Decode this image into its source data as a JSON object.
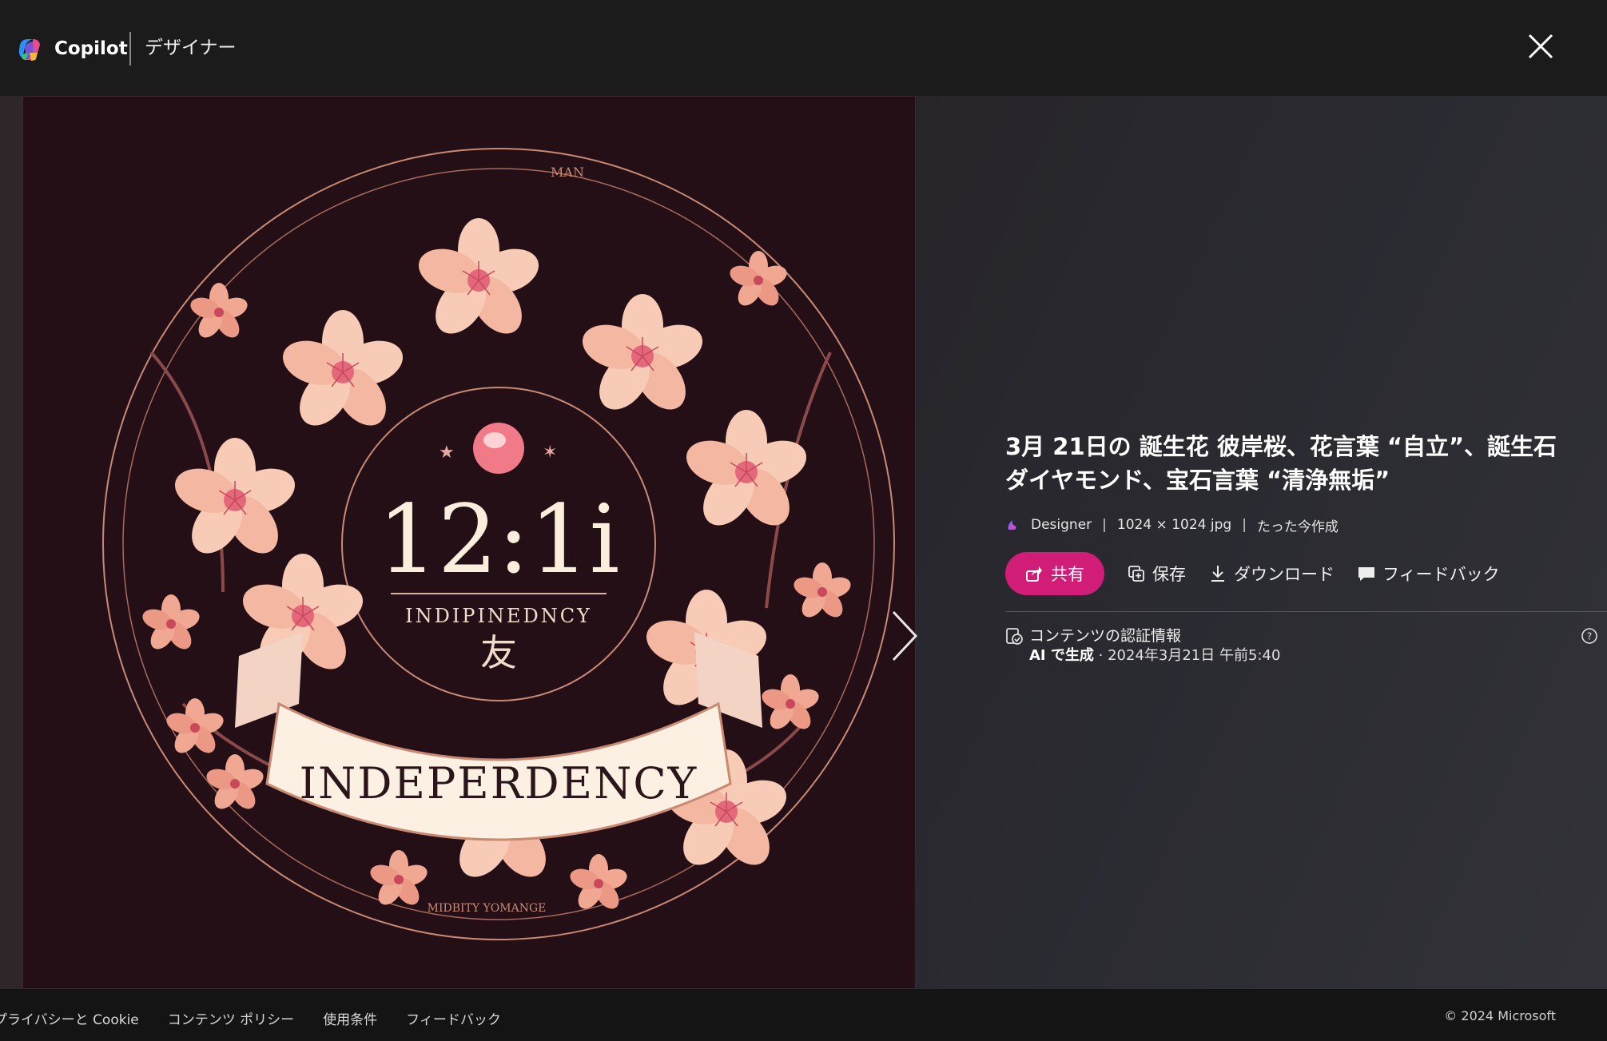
{
  "header": {
    "brand": "Copilot",
    "sub_brand": "デザイナー",
    "close_icon": "close-icon"
  },
  "image": {
    "numerals": "12:1i",
    "small_text": "INDIPINEDNCY",
    "kanji": "友",
    "banner_text": "INDEPERDENCY",
    "ring_top": "MAN",
    "ring_bottom": "MIDBITY YOMANGE"
  },
  "info": {
    "title": "3月 21日の 誕生花 彼岸桜、花言葉 “自立”、誕生石 ダイヤモンド、宝石言葉 “清浄無垢”",
    "meta": {
      "source": "Designer",
      "size": "1024 × 1024 jpg",
      "created": "たった今作成"
    },
    "actions": {
      "share": "共有",
      "save": "保存",
      "download": "ダウンロード",
      "feedback": "フィードバック"
    },
    "credentials": {
      "title": "コンテンツの認証情報",
      "ai_label": "AI で生成",
      "date": "· 2024年3月21日 午前5:40"
    }
  },
  "footer": {
    "links": [
      "プライバシーと Cookie",
      "コンテンツ ポリシー",
      "使用条件",
      "フィードバック"
    ],
    "copyright": "© 2024 Microsoft"
  },
  "colors": {
    "accent": "#d21d78",
    "background": "#1c1c1c",
    "petal": "#f6c3b0",
    "image_bg": "#240f16"
  }
}
